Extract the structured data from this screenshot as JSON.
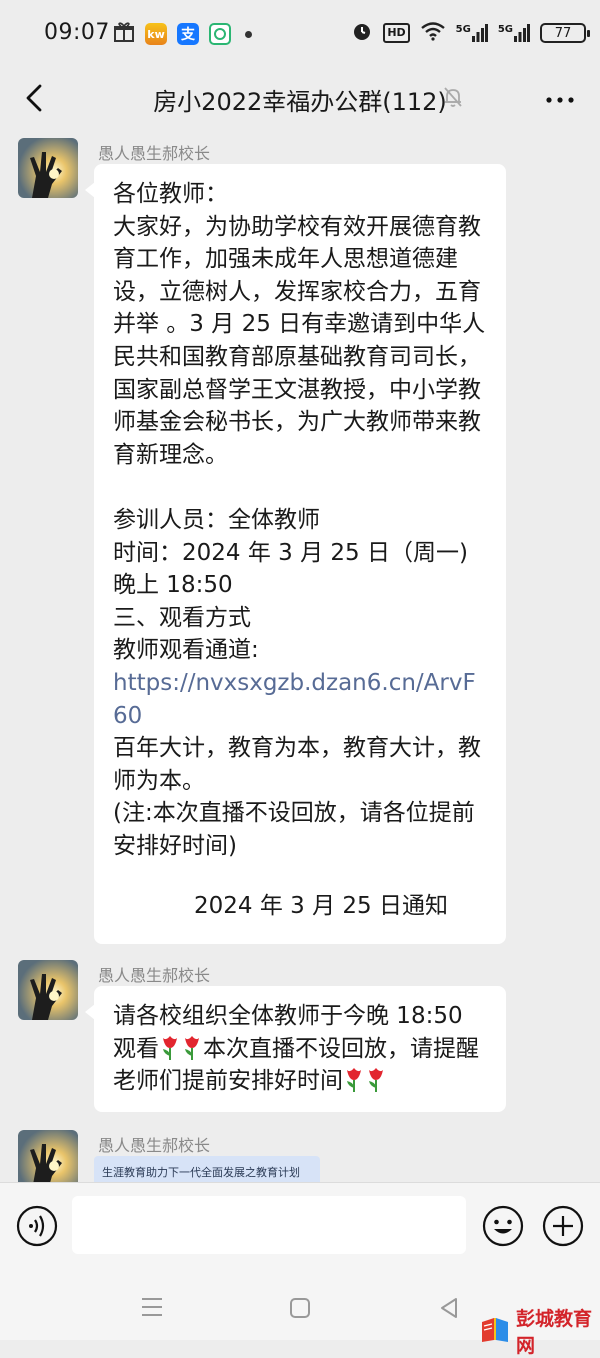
{
  "status_bar": {
    "time": "09:07",
    "battery": "77",
    "kw_badge": "kw",
    "alipay_glyph": "支",
    "signal_hd": "HD",
    "signal_5g_1": "5G",
    "signal_5g_2": "5G"
  },
  "header": {
    "title": "房小2022幸福办公群(112)",
    "icons": [
      "back-arrow-icon",
      "bell-muted-icon",
      "more-dots-icon"
    ]
  },
  "messages": [
    {
      "sender": "愚人愚生郝校长",
      "lines_before_link": "各位教师：\n大家好，为协助学校有效开展德育教育工作，加强未成年人思想道德建设，立德树人，发挥家校合力，五育并举 。3 月 25 日有幸邀请到中华人民共和国教育部原基础教育司司长，国家副总督学王文湛教授，中小学教师基金会秘书长，为广大教师带来教育新理念。\n\n参训人员：全体教师\n时间：2024 年 3 月 25 日（周一)晚上 18:50\n三、观看方式\n教师观看通道:",
      "link": "https://nvxsxgzb.dzan6.cn/ArvF60",
      "lines_after_link": "百年大计，教育为本，教育大计，教师为本。\n(注:本次直播不设回放，请各位提前安排好时间)",
      "signature": "2024 年 3 月 25 日通知"
    },
    {
      "sender": "愚人愚生郝校长",
      "part1": "请各校组织全体教师于今晚 18:50 观看",
      "part2": "本次直播不设回放，请提醒老师们提前安排好时间",
      "emoji": "tulip"
    },
    {
      "sender": "愚人愚生郝校长",
      "card_title": "生涯教育助力下一代全面发展之教育计划"
    }
  ],
  "input_bar": {
    "placeholder": "",
    "icons": [
      "voice-icon",
      "emoji-icon",
      "plus-icon"
    ]
  },
  "nav_bar": {
    "icons": [
      "menu-icon",
      "home-icon",
      "back-triangle-icon"
    ]
  },
  "watermark": {
    "text": "彭城教育网"
  },
  "colors": {
    "background": "#ededed",
    "bubble": "#ffffff",
    "link": "#576b95",
    "sender": "#8a8a8a",
    "watermark": "#d3242a"
  }
}
